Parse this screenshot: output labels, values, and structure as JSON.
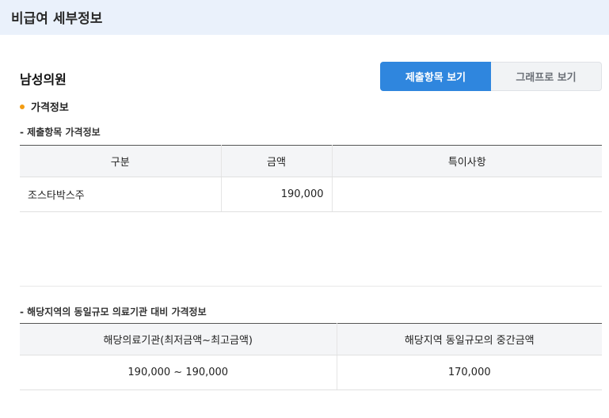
{
  "header": {
    "title": "비급여 세부정보"
  },
  "institution": {
    "name": "남성의원"
  },
  "view_toggle": {
    "submitted_items_label": "제출항목 보기",
    "graph_label": "그래프로 보기"
  },
  "section": {
    "title": "가격정보"
  },
  "submitted_prices": {
    "title": "- 제출항목 가격정보",
    "columns": [
      "구분",
      "금액",
      "특이사항"
    ],
    "rows": [
      {
        "category": "조스타박스주",
        "amount": "190,000",
        "note": ""
      }
    ]
  },
  "regional_prices": {
    "title": "- 해당지역의 동일규모 의료기관 대비 가격정보",
    "columns": [
      "해당의료기관(최저금액~최고금액)",
      "해당지역 동일규모의 중간금액"
    ],
    "rows": [
      {
        "range": "190,000 ~ 190,000",
        "median": "170,000"
      }
    ]
  },
  "colors": {
    "header_bg": "#eaf1fb",
    "primary_button": "#2f86de",
    "bullet": "#f39c12"
  }
}
